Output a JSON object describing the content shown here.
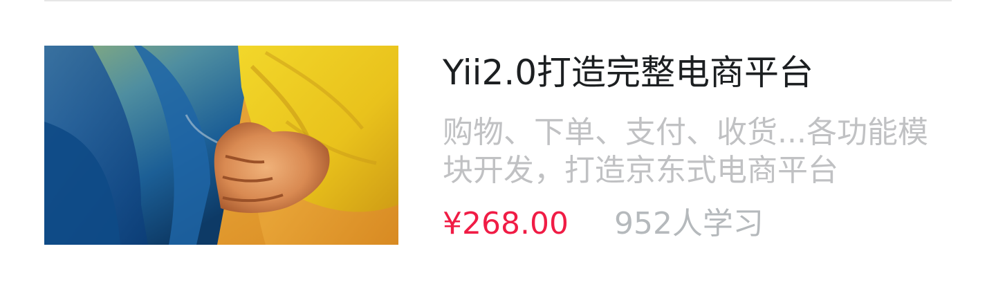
{
  "course": {
    "title": "Yii2.0打造完整电商平台",
    "description": "购物、下单、支付、收货...各功能模块开发，打造京东式电商平台",
    "price": "¥268.00",
    "learners": "952人学习",
    "thumbnail_icon": "fist-illustration",
    "colors": {
      "title": "#1c1f21",
      "description": "#c0c1c3",
      "price": "#f01c45",
      "learners": "#b5b9bc"
    }
  }
}
